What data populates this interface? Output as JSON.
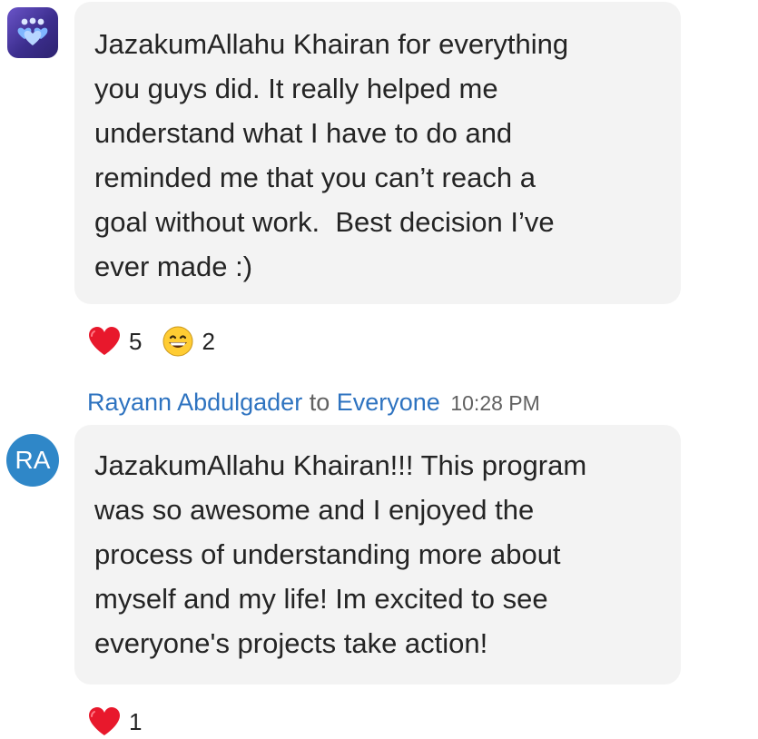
{
  "messages": [
    {
      "avatar_icon": "group-hearts-icon",
      "avatar_colors": [
        "#6a54c8",
        "#2d2370"
      ],
      "text": "JazakumAllahu Khairan for everything you guys did. It really helped me understand what I have to do and reminded me that you can’t reach a goal without work.  Best decision I’ve ever made :)",
      "lines": [
        "JazakumAllahu Khairan for everything",
        "you guys did. It really helped me",
        "understand what I have to do and",
        "reminded me that you can’t reach a",
        "goal without work.  Best decision I’ve",
        "ever made :)"
      ],
      "reactions": [
        {
          "icon": "heart-icon",
          "count": "5"
        },
        {
          "icon": "grinning-face-icon",
          "count": "2"
        }
      ]
    },
    {
      "sender": "Rayann Abdulgader",
      "to_word": "to",
      "recipient": "Everyone",
      "time": "10:28 PM",
      "avatar_initials": "RA",
      "avatar_color": "#2f87c8",
      "lines": [
        "JazakumAllahu Khairan!!! This program",
        "was so awesome and I enjoyed the",
        "process of understanding more about",
        "myself and my life! Im excited to see",
        "everyone's projects take action!"
      ],
      "reactions": [
        {
          "icon": "heart-icon",
          "count": "1"
        }
      ]
    }
  ],
  "colors": {
    "bubble": "#f3f3f3",
    "link": "#2e73c0",
    "muted": "#616161",
    "heart": "#e8182c",
    "emoji": "#ffcc33"
  }
}
